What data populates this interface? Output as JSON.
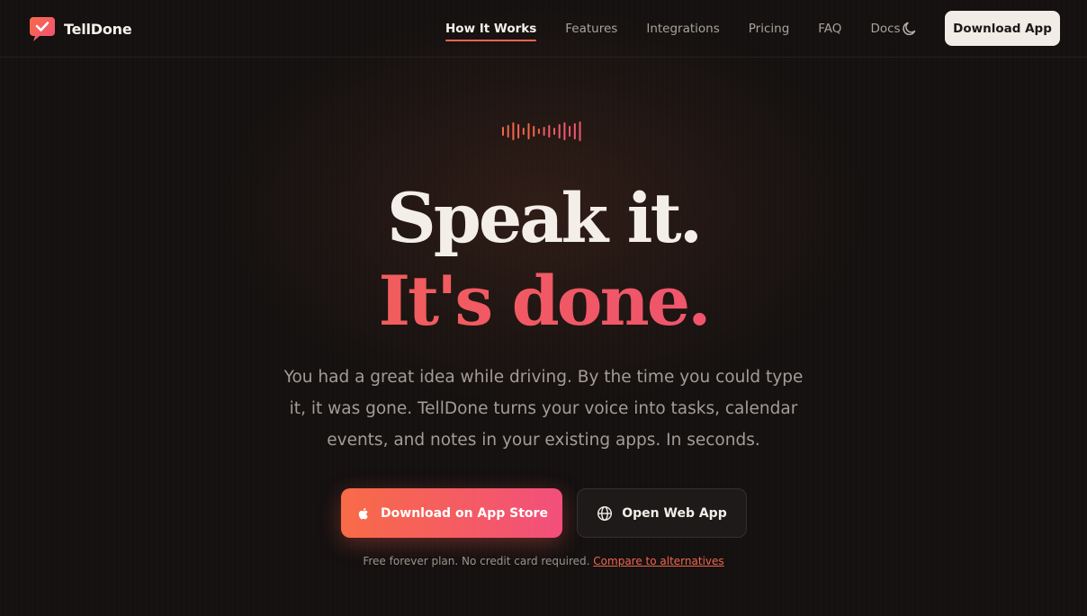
{
  "brand": {
    "name": "TellDone",
    "accent": "#f0654e",
    "gradient_start": "#f86b47",
    "gradient_end": "#f24f7b"
  },
  "nav": {
    "links": [
      {
        "label": "How It Works",
        "active": true
      },
      {
        "label": "Features",
        "active": false
      },
      {
        "label": "Integrations",
        "active": false
      },
      {
        "label": "Pricing",
        "active": false
      },
      {
        "label": "FAQ",
        "active": false
      },
      {
        "label": "Docs",
        "active": false
      }
    ],
    "theme_toggle_icon": "moon-icon",
    "download_label": "Download App"
  },
  "hero": {
    "wave_icon": "sound-wave-icon",
    "headline_line1": "Speak it.",
    "headline_line2": "It's done.",
    "subtitle": "You had a great idea while driving. By the time you could type it, it was gone. TellDone turns your voice into tasks, calendar events, and notes in your existing apps. In seconds.",
    "primary_cta": {
      "label": "Download on App Store",
      "icon": "apple-icon"
    },
    "secondary_cta": {
      "label": "Open Web App",
      "icon": "globe-icon"
    },
    "footnote_text": "Free forever plan. No credit card required.",
    "footnote_link": "Compare to alternatives"
  }
}
